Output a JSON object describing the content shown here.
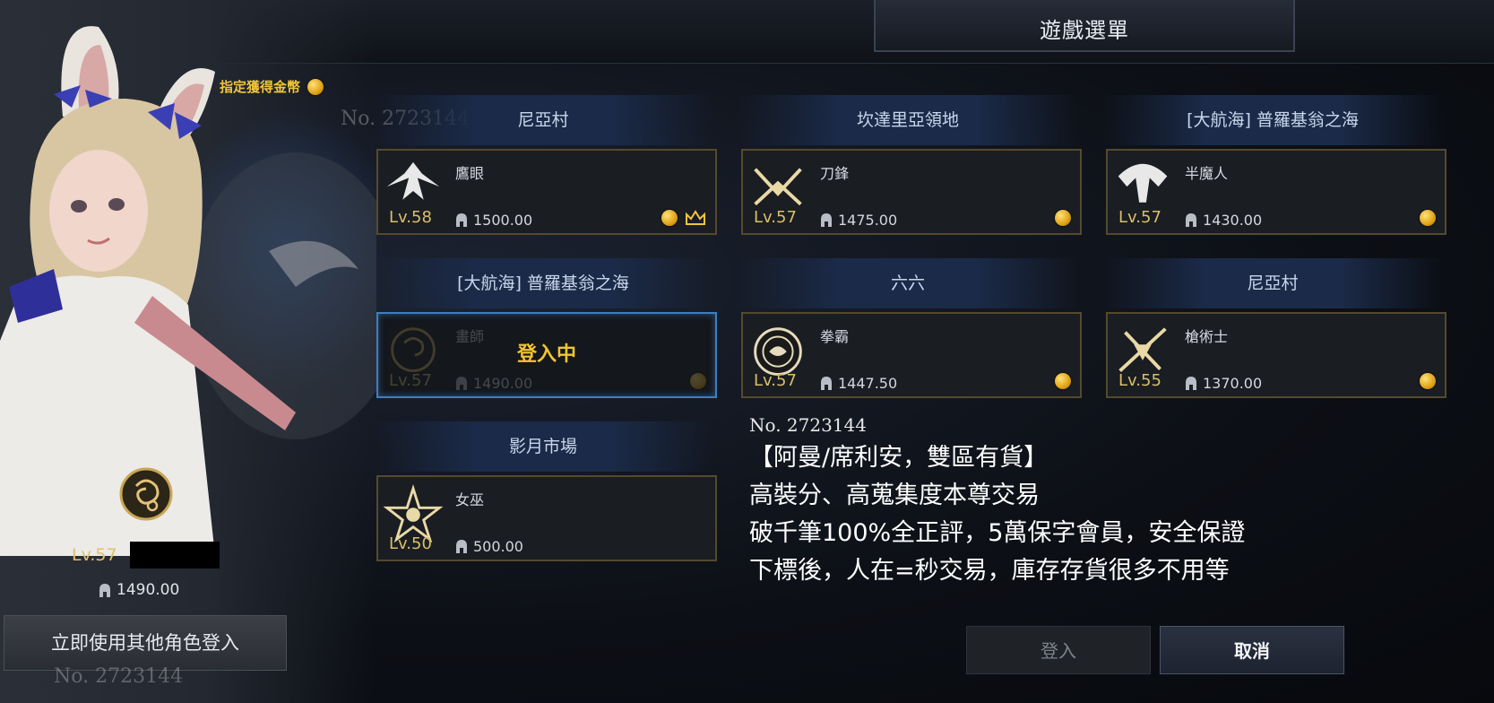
{
  "window": {
    "title": "遊戲選單"
  },
  "character": {
    "gold_reward_label": "指定獲得金幣",
    "level": "Lv.57",
    "item_level": "1490.00",
    "login_other_button": "立即使用其他角色登入"
  },
  "cards": [
    {
      "server": "尼亞村",
      "class": "鷹眼",
      "level": "Lv.58",
      "item_level": "1500.00",
      "coin": true,
      "crown": true,
      "icon": "hawkeye-class-icon"
    },
    {
      "server": "坎達里亞領地",
      "class": "刀鋒",
      "level": "Lv.57",
      "item_level": "1475.00",
      "coin": true,
      "crown": false,
      "icon": "blade-class-icon"
    },
    {
      "server": "[大航海] 普羅基翁之海",
      "class": "半魔人",
      "level": "Lv.57",
      "item_level": "1430.00",
      "coin": true,
      "crown": false,
      "icon": "demonic-class-icon"
    },
    {
      "server": "[大航海] 普羅基翁之海",
      "class": "畫師",
      "level": "Lv.57",
      "item_level": "1490.00",
      "coin": true,
      "crown": false,
      "icon": "artist-class-icon",
      "status": "登入中"
    },
    {
      "server": "六六",
      "class": "拳霸",
      "level": "Lv.57",
      "item_level": "1447.50",
      "coin": true,
      "crown": false,
      "icon": "striker-class-icon"
    },
    {
      "server": "尼亞村",
      "class": "槍術士",
      "level": "Lv.55",
      "item_level": "1370.00",
      "coin": true,
      "crown": false,
      "icon": "lancer-class-icon"
    },
    {
      "server": "影月市場",
      "class": "女巫",
      "level": "Lv.50",
      "item_level": "500.00",
      "coin": false,
      "crown": false,
      "icon": "sorceress-class-icon"
    }
  ],
  "listing": {
    "number": "No. 2723144",
    "lines": [
      "【阿曼/席利安，雙區有貨】",
      "高裝分、高蒐集度本尊交易",
      "破千筆100%全正評，5萬保字會員，安全保證",
      "下標後，人在=秒交易，庫存存貨很多不用等"
    ]
  },
  "watermarks": [
    "No. 2723144",
    "No. 2723144"
  ],
  "buttons": {
    "login": "登入",
    "cancel": "取消"
  },
  "colors": {
    "accent_gold": "#f3c531",
    "active_border": "#3e7fc0",
    "card_border": "#554a2e"
  }
}
